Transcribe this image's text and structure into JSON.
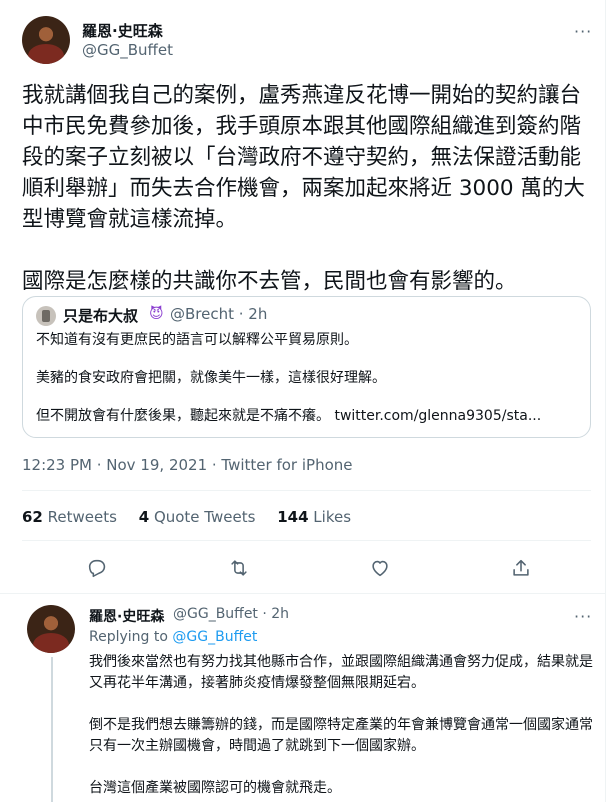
{
  "tweet": {
    "author_name": "羅恩·史旺森",
    "author_handle": "@GG_Buffet",
    "more": "···",
    "paragraphs": [
      "我就講個我自己的案例，盧秀燕違反花博一開始的契約讓台中市民免費參加後，我手頭原本跟其他國際組織進到簽約階段的案子立刻被以「台灣政府不遵守契約，無法保證活動能順利舉辦」而失去合作機會，兩案加起來將近 3000 萬的大型博覽會就這樣流掉。",
      "國際是怎麼樣的共識你不去管，民間也會有影響的。"
    ],
    "quote": {
      "name": "只是布大叔",
      "emoji": "😈",
      "handle_time": "@Brecht · 2h",
      "lines": [
        "不知道有沒有更庶民的語言可以解釋公平貿易原則。",
        "美豬的食安政府會把關，就像美牛一樣，這樣很好理解。",
        "但不開放會有什麼後果，聽起來就是不痛不癢。 twitter.com/glenna9305/sta..."
      ]
    },
    "timestamp": "12:23 PM · Nov 19, 2021 · Twitter for iPhone",
    "stats": [
      {
        "count": "62",
        "label": "Retweets"
      },
      {
        "count": "4",
        "label": "Quote Tweets"
      },
      {
        "count": "144",
        "label": "Likes"
      }
    ],
    "actions": [
      "reply-icon",
      "retweet-icon",
      "like-icon",
      "share-icon"
    ]
  },
  "reply": {
    "author_name": "羅恩·史旺森",
    "handle_time": "@GG_Buffet · 2h",
    "more": "···",
    "replying_prefix": "Replying to",
    "replying_to": "@GG_Buffet",
    "paragraphs": [
      "我們後來當然也有努力找其他縣市合作，並跟國際組織溝通會努力促成，結果就是又再花半年溝通，接著肺炎疫情爆發整個無限期延宕。",
      "倒不是我們想去賺籌辦的錢，而是國際特定產業的年會兼博覽會通常一個國家通常只有一次主辦國機會，時間過了就跳到下一個國家辦。",
      "台灣這個產業被國際認可的機會就飛走。"
    ]
  },
  "colors": {
    "text": "#0f1419",
    "secondary": "#536471",
    "link": "#1d9bf0",
    "border": "#eff3f4"
  }
}
